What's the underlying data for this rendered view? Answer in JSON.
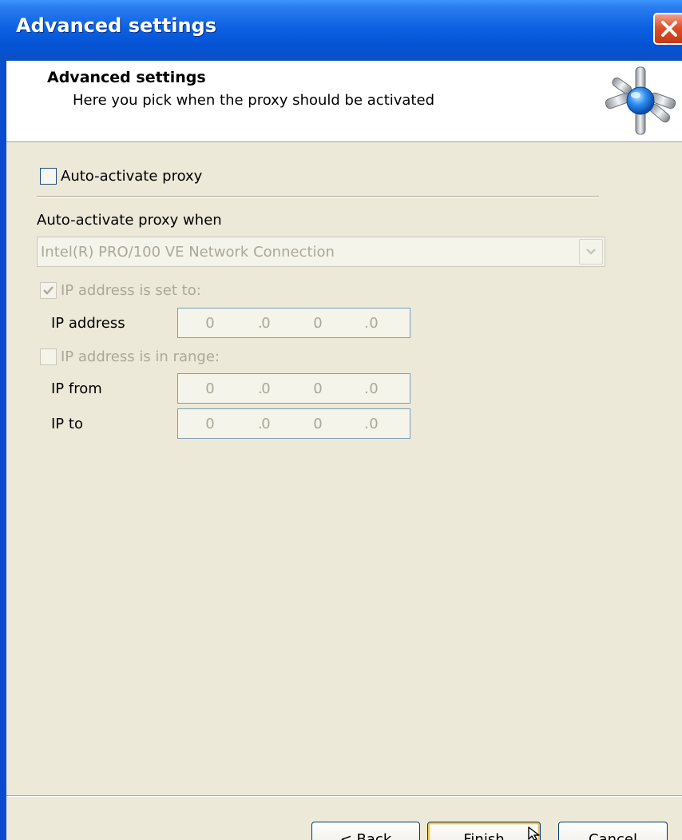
{
  "window": {
    "title": "Advanced settings"
  },
  "header": {
    "title": "Advanced settings",
    "subtitle": "Here you pick when the proxy should be activated",
    "icon": "network-hub-icon"
  },
  "auto_activate": {
    "label": "Auto-activate proxy",
    "checked": false
  },
  "condition_group": {
    "label": "Auto-activate proxy when",
    "adapter": {
      "selected": "Intel(R) PRO/100 VE Network Connection",
      "enabled": false
    }
  },
  "ip_set": {
    "label": "IP address is set to:",
    "checked": true,
    "enabled": false,
    "field_label": "IP address",
    "octets": [
      "0",
      "0",
      "0",
      "0"
    ]
  },
  "ip_range": {
    "label": "IP address is in range:",
    "checked": false,
    "enabled": false,
    "from_label": "IP from",
    "from_octets": [
      "0",
      "0",
      "0",
      "0"
    ],
    "to_label": "IP to",
    "to_octets": [
      "0",
      "0",
      "0",
      "0"
    ]
  },
  "buttons": {
    "back": "< Back",
    "finish": "Finish",
    "cancel": "Cancel"
  },
  "colors": {
    "titlebar": "#0a5fe0",
    "dialog_bg": "#ece9d8",
    "disabled_text": "#aca899",
    "close_button": "#e0502a"
  }
}
